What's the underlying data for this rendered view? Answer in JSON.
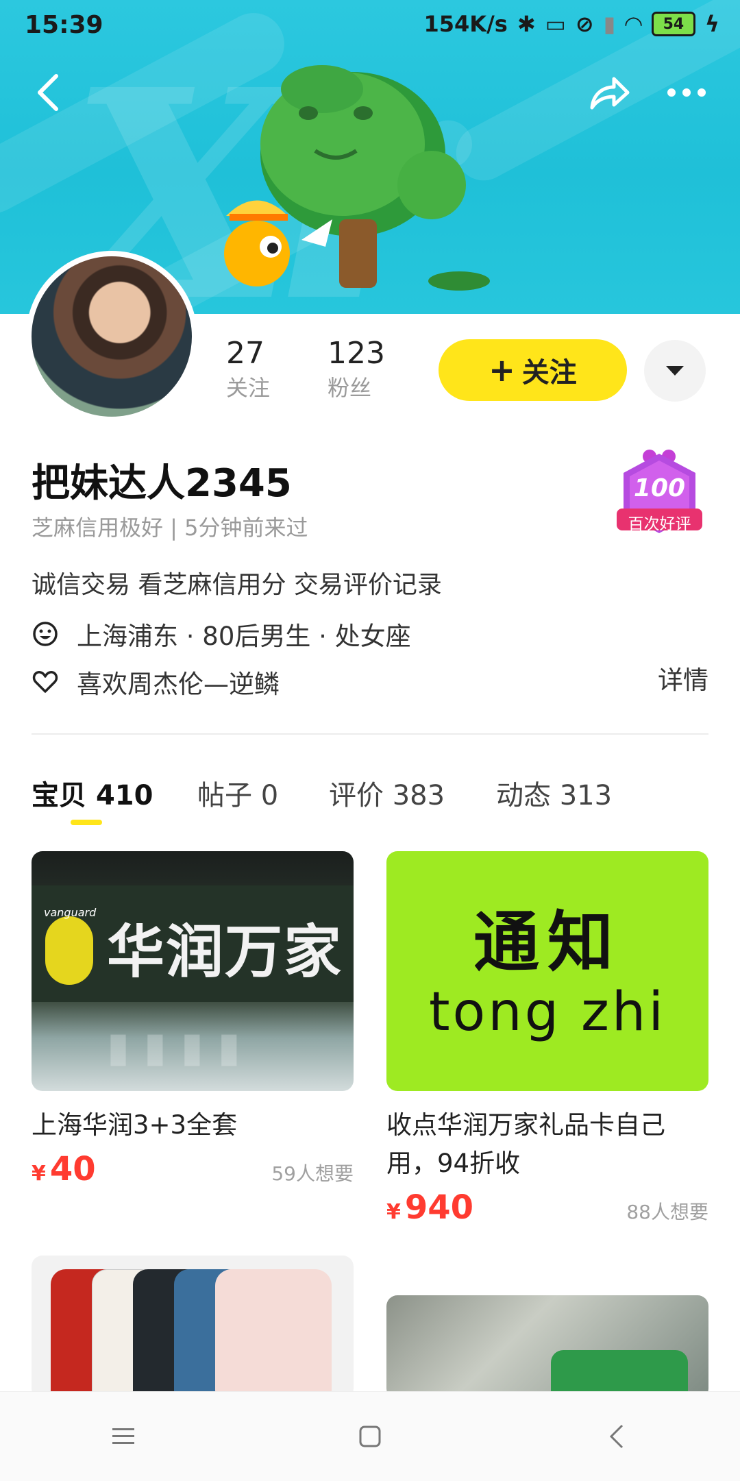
{
  "status_bar": {
    "time": "15:39",
    "speed": "154K/s",
    "battery": "54"
  },
  "profile": {
    "following_count": "27",
    "following_label": "关注",
    "fans_count": "123",
    "fans_label": "粉丝",
    "follow_button": "关注",
    "nickname": "把妹达人2345",
    "credit_line": "芝麻信用极好 | 5分钟前来过",
    "bio": "诚信交易 看芝麻信用分 交易评价记录",
    "location_info": "上海浦东 · 80后男生 · 处女座",
    "likes": "喜欢周杰伦—逆鳞",
    "detail_link": "详情",
    "badge_number": "100",
    "badge_text": "百次好评"
  },
  "tabs": [
    {
      "label": "宝贝",
      "count": "410"
    },
    {
      "label": "帖子",
      "count": "0"
    },
    {
      "label": "评价",
      "count": "383"
    },
    {
      "label": "动态",
      "count": "313"
    }
  ],
  "items": [
    {
      "title": "上海华润3+3全套",
      "currency": "¥",
      "price": "40",
      "want": "59人想要",
      "image_text": "华润万家",
      "image_subtext": "vanguard"
    },
    {
      "title": "收点华润万家礼品卡自己用，94折收",
      "currency": "¥",
      "price": "940",
      "want": "88人想要",
      "image_text": "通知",
      "image_subtext": "tong zhi"
    }
  ],
  "colors": {
    "accent": "#ffe51a",
    "price": "#ff3b30",
    "banner": "#22c3da",
    "badge": "#c43fd6"
  },
  "icons": [
    "back-icon",
    "share-icon",
    "more-icon",
    "caret-down-icon",
    "face-icon",
    "heart-icon",
    "menu-icon",
    "home-icon",
    "nav-back-icon"
  ]
}
